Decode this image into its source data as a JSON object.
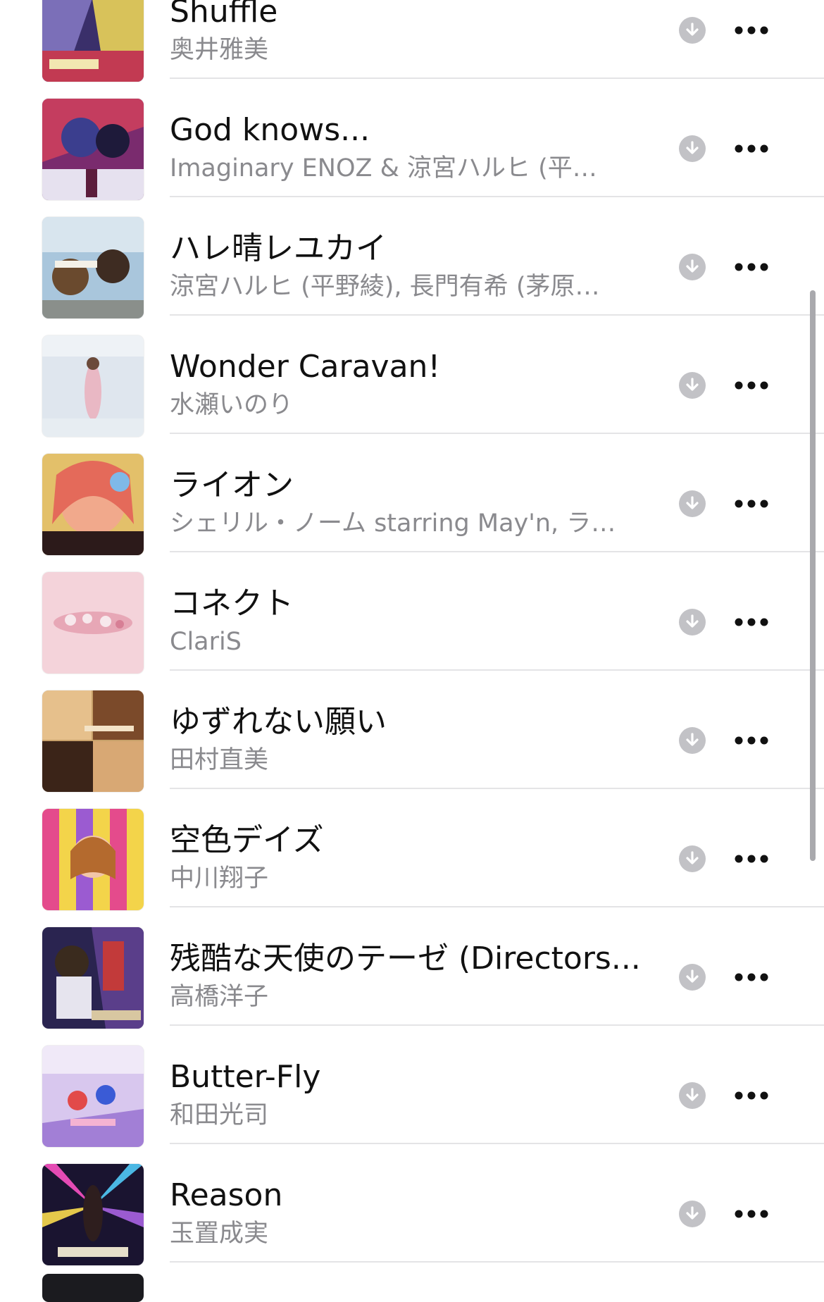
{
  "songs": [
    {
      "title": "Shuffle",
      "artist": "奥井雅美"
    },
    {
      "title": "God knows...",
      "artist": "Imaginary ENOZ & 涼宮ハルヒ (平…"
    },
    {
      "title": "ハレ晴レユカイ",
      "artist": "涼宮ハルヒ (平野綾), 長門有希 (茅原…"
    },
    {
      "title": "Wonder Caravan!",
      "artist": "水瀬いのり"
    },
    {
      "title": "ライオン",
      "artist": "シェリル・ノーム starring May'n, ラ…"
    },
    {
      "title": "コネクト",
      "artist": "ClariS"
    },
    {
      "title": "ゆずれない願い",
      "artist": "田村直美"
    },
    {
      "title": "空色デイズ",
      "artist": "中川翔子"
    },
    {
      "title": "残酷な天使のテーゼ (Directors...",
      "artist": "高橋洋子"
    },
    {
      "title": "Butter-Fly",
      "artist": "和田光司"
    },
    {
      "title": "Reason",
      "artist": "玉置成実"
    }
  ],
  "icons": {
    "download": "download-icon",
    "more": "more-icon"
  },
  "colors": {
    "title": "#111111",
    "subtitle": "#8a8a8e",
    "icon": "#c2c2c6",
    "separator": "#e4e4e6"
  }
}
